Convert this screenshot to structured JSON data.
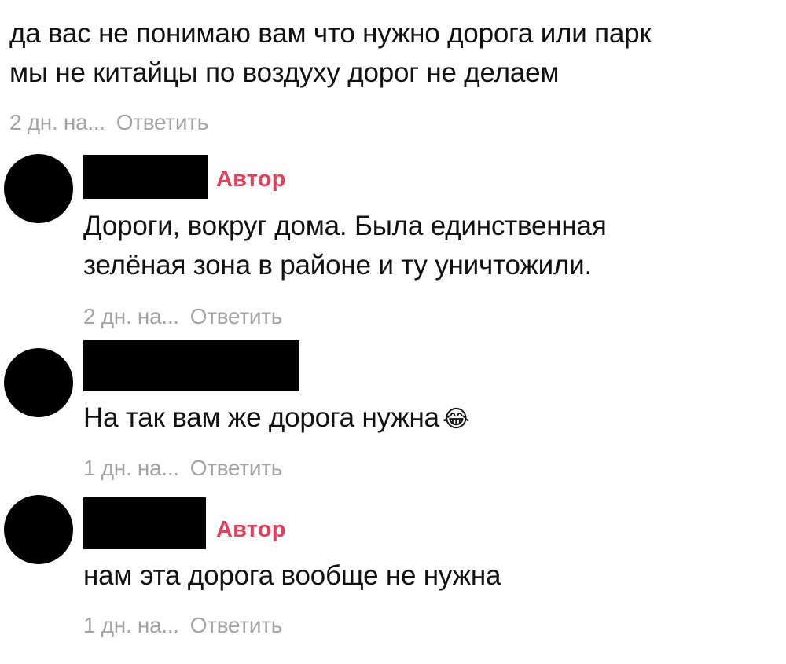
{
  "top_comment": {
    "lines": [
      "да вас не понимаю вам что нужно дорога или парк",
      "мы не китайцы по воздуху дорог не делаем"
    ],
    "time": "2 дн. на...",
    "reply_label": "Ответить"
  },
  "replies": [
    {
      "author_badge": "Автор",
      "lines": [
        "Дороги, вокруг дома. Была единственная",
        "зелёная зона в районе и ту уничтожили."
      ],
      "time": "2 дн. на...",
      "reply_label": "Ответить"
    },
    {
      "lines": [
        "На так вам же дорога нужна"
      ],
      "emoji": "😂",
      "time": "1 дн. на...",
      "reply_label": "Ответить"
    },
    {
      "author_badge": "Автор",
      "lines": [
        "нам эта дорога вообще не нужна"
      ],
      "time": "1 дн. на...",
      "reply_label": "Ответить"
    }
  ],
  "colors": {
    "author_badge": "#e0405a",
    "meta_text": "#a3a3a3",
    "redaction": "#000000"
  }
}
